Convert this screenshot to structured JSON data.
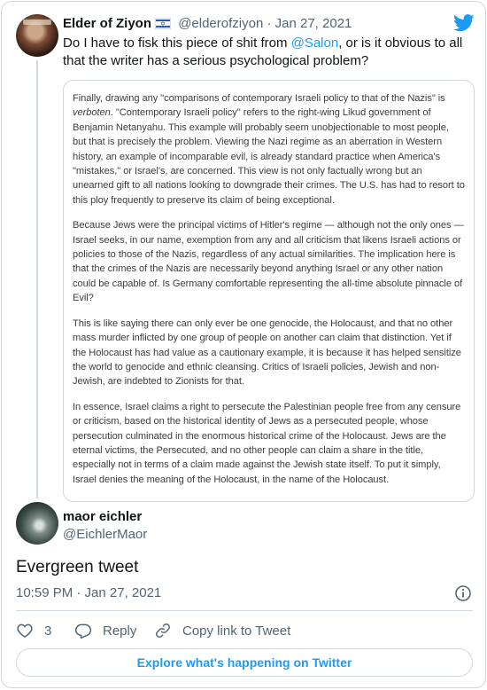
{
  "parent_tweet": {
    "name": "Elder of Ziyon",
    "handle": "@elderofziyon",
    "separator": "·",
    "date": "Jan 27, 2021",
    "text_before": "Do I have to fisk this piece of shit from ",
    "mention": "@Salon",
    "text_after": ", or is it obvious to all that the writer has a serious psychological problem?",
    "screenshot_paragraphs": [
      "Finally, drawing any \"comparisons of contemporary Israeli policy to that of the Nazis\" is verboten. \"Contemporary Israeli policy\" refers to the right-wing Likud government of Benjamin Netanyahu. This example will probably seem unobjectionable to most people, but that is precisely the problem. Viewing the Nazi regime as an aberration in Western history, an example of incomparable evil, is already standard practice when America's \"mistakes,\" or Israel's, are concerned. This view is not only factually wrong but an unearned gift to all nations looking to downgrade their crimes. The U.S. has had to resort to this ploy frequently to preserve its claim of being exceptional.",
      "Because Jews were the principal victims of Hitler's regime — although not the only ones — Israel seeks, in our name, exemption from any and all criticism that likens Israeli actions or policies to those of the Nazis, regardless of any actual similarities. The implication here is that the crimes of the Nazis are necessarily beyond anything Israel or any other nation could be capable of. Is Germany comfortable representing the all-time absolute pinnacle of Evil?",
      "This is like saying there can only ever be one genocide, the Holocaust, and that no other mass murder inflicted by one group of people on another can claim that distinction. Yet if the Holocaust has had value as a cautionary example, it is because it has helped sensitize the world to genocide and ethnic cleansing. Critics of Israeli policies, Jewish and non-Jewish, are indebted to Zionists for that.",
      "In essence, Israel claims a right to persecute the Palestinian people free from any censure or criticism, based on the historical identity of Jews as a persecuted people, whose persecution culminated in the enormous historical crime of the Holocaust. Jews are the eternal victims, the Persecuted, and no other people can claim a share in the title, especially not in terms of a claim made against the Jewish state itself. To put it simply, Israel denies the meaning of the Holocaust, in the name of the Holocaust."
    ]
  },
  "tweet": {
    "name": "maor eichler",
    "handle": "@EichlerMaor",
    "text": "Evergreen tweet",
    "timestamp": "10:59 PM · Jan 27, 2021"
  },
  "actions": {
    "like_count": "3",
    "reply_label": "Reply",
    "copy_label": "Copy link to Tweet"
  },
  "explore_label": "Explore what's happening on Twitter",
  "colors": {
    "accent": "#1d9bf0",
    "secondary_text": "#536471",
    "border": "#cfd9de"
  },
  "icons": [
    "twitter-bird-icon",
    "israel-flag-icon",
    "info-icon",
    "heart-icon",
    "reply-icon",
    "link-icon"
  ]
}
